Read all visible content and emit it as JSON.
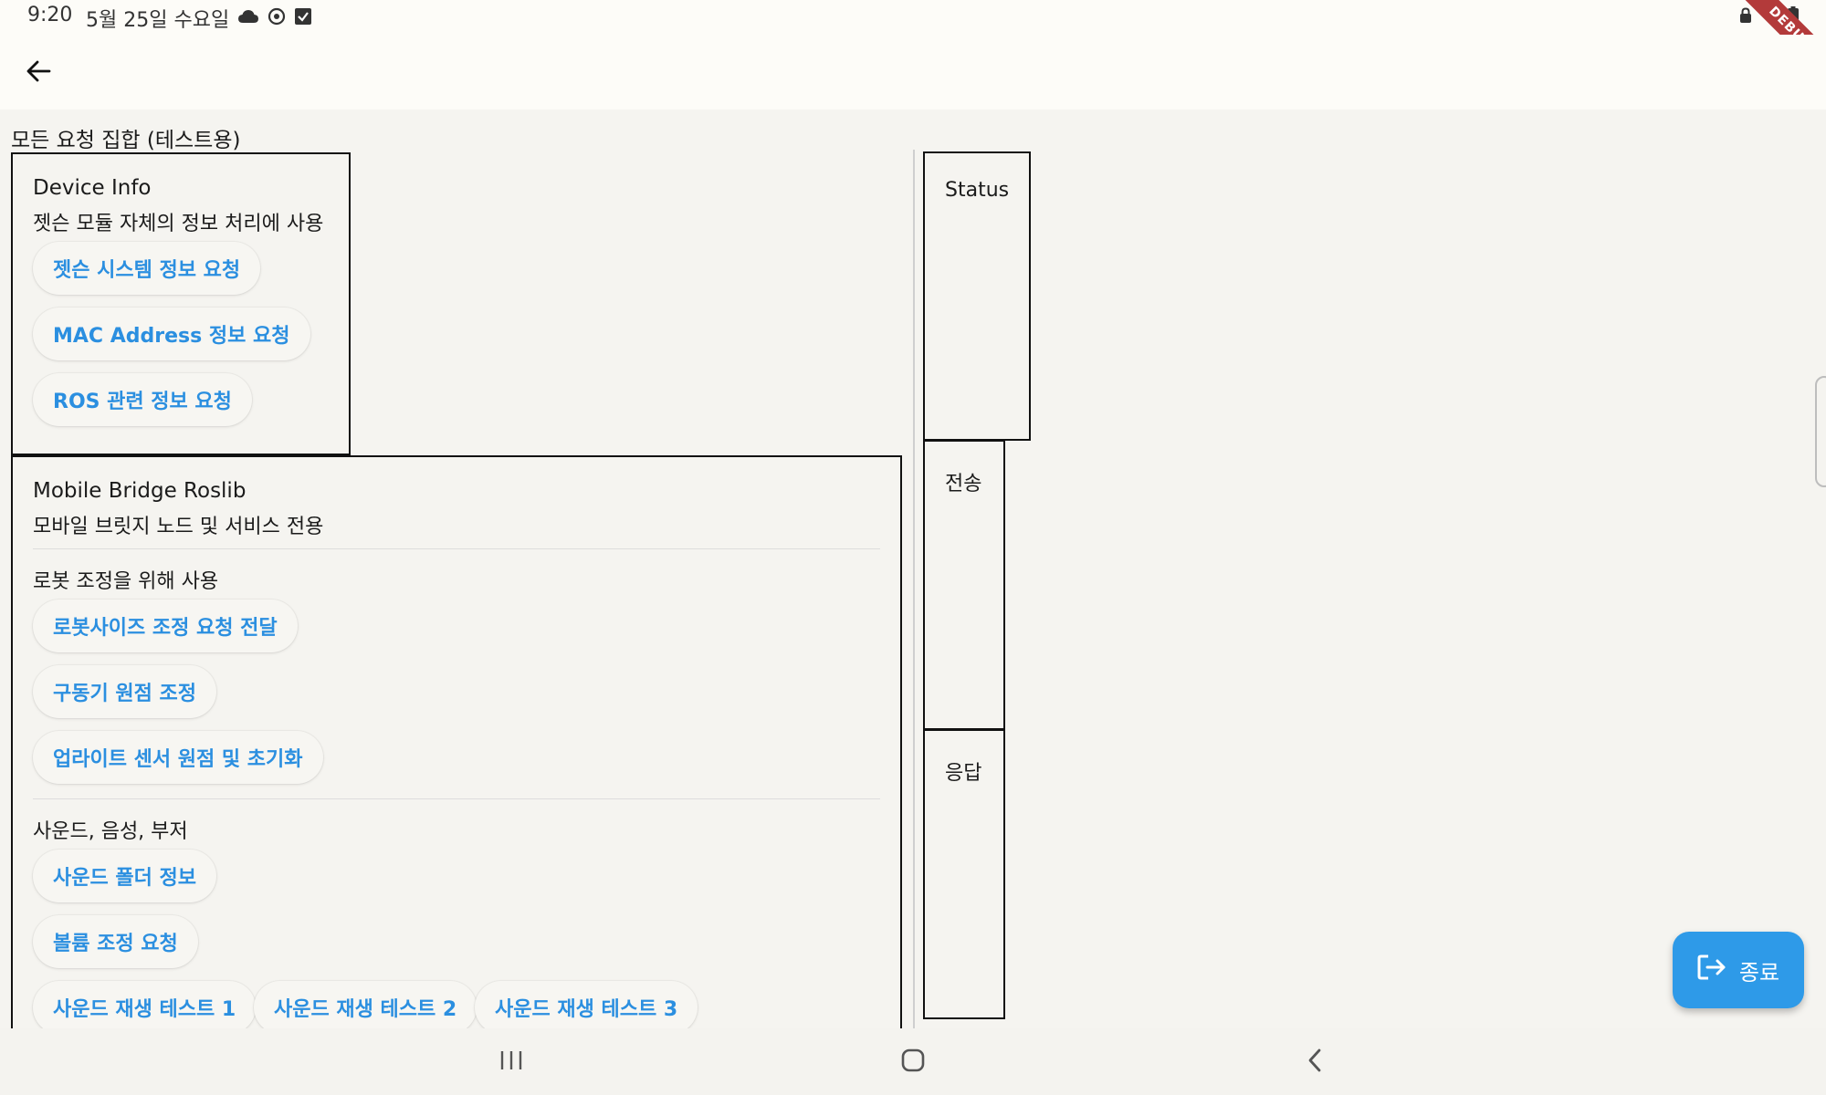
{
  "status_bar": {
    "time": "9:20",
    "date": "5월 25일 수요일",
    "left_icons": [
      "cloud-icon",
      "sync-icon",
      "checkbox-icon"
    ],
    "right_icons": [
      "lock-icon",
      "wifi-icon",
      "battery-icon"
    ]
  },
  "debug_banner": "DEBUG",
  "appbar": {
    "back_icon": "arrow-back-icon"
  },
  "page_title": "모든 요청 집합 (테스트용)",
  "device_info": {
    "title": "Device Info",
    "subtitle": "젯슨 모듈 자체의 정보 처리에 사용",
    "buttons": [
      "젯슨 시스템 정보 요청",
      "MAC Address 정보 요청",
      "ROS 관련 정보 요청"
    ]
  },
  "mobile_bridge": {
    "title": "Mobile Bridge Roslib",
    "subtitle": "모바일 브릿지 노드 및 서비스 전용",
    "groups": [
      {
        "label": "로봇 조정을 위해 사용",
        "buttons": [
          "로봇사이즈 조정 요청 전달",
          "구동기 원점 조정",
          "업라이트 센서 원점 및 초기화"
        ]
      },
      {
        "label": "사운드, 음성, 부저",
        "buttons": [
          "사운드 폴더 정보",
          "볼륨 조정 요청",
          "사운드 재생 테스트 1",
          "사운드 재생 테스트 2",
          "사운드 재생 테스트 3"
        ]
      }
    ]
  },
  "panels": {
    "status": "Status",
    "send": "전송",
    "response": "응답"
  },
  "fab": {
    "label": "종료",
    "icon": "logout-icon"
  },
  "navbar": {
    "icons": [
      "recent-apps-icon",
      "home-icon",
      "nav-back-icon"
    ]
  }
}
